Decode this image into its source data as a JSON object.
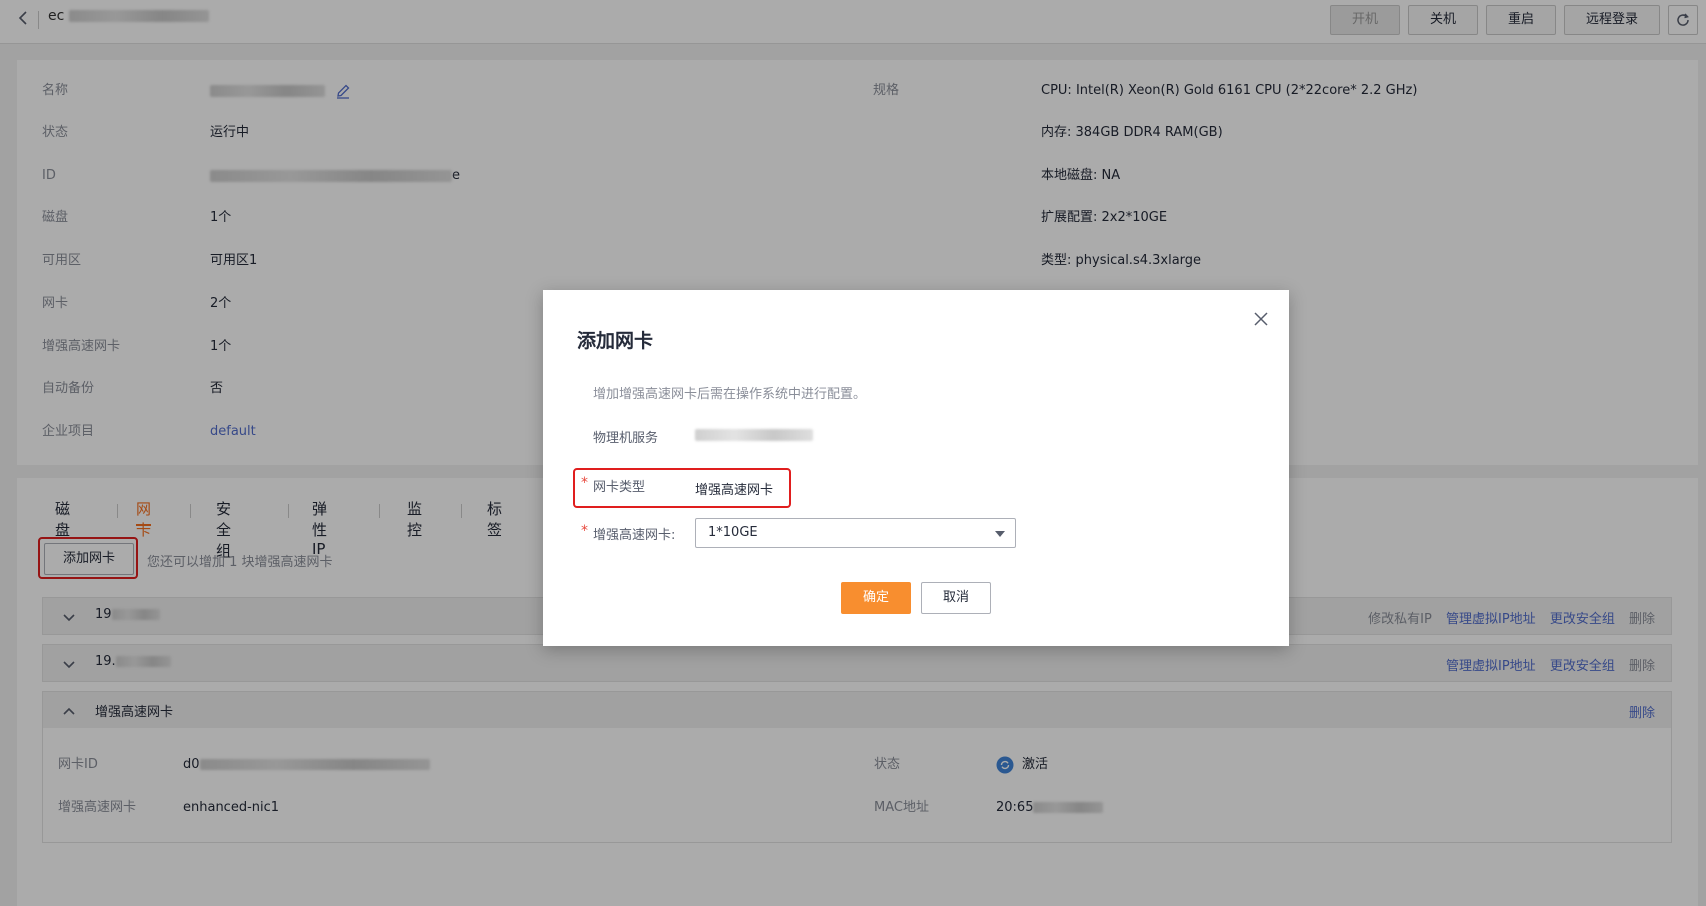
{
  "topbar": {
    "title": "ec",
    "buttons": {
      "power_on": "开机",
      "power_off": "关机",
      "restart": "重启",
      "remote_login": "远程登录"
    }
  },
  "info": {
    "left": [
      {
        "label": "名称",
        "value": ""
      },
      {
        "label": "状态",
        "value": "运行中"
      },
      {
        "label": "ID",
        "value": "e"
      },
      {
        "label": "磁盘",
        "value": "1个"
      },
      {
        "label": "可用区",
        "value": "可用区1"
      },
      {
        "label": "网卡",
        "value": "2个"
      },
      {
        "label": "增强高速网卡",
        "value": "1个"
      },
      {
        "label": "自动备份",
        "value": "否"
      },
      {
        "label": "企业项目",
        "value": "default"
      }
    ],
    "spec_label": "规格",
    "spec": [
      "CPU: Intel(R) Xeon(R) Gold 6161 CPU (2*22core* 2.2 GHz)",
      "内存: 384GB DDR4 RAM(GB)",
      "本地磁盘: NA",
      "扩展配置: 2x2*10GE",
      "类型: physical.s4.3xlarge"
    ]
  },
  "tabs": [
    "磁盘",
    "网卡",
    "安全组",
    "弹性IP",
    "监控",
    "标签"
  ],
  "nic_section": {
    "add_button": "添加网卡",
    "hint": "您还可以增加 1 块增强高速网卡",
    "rows": [
      {
        "name": "19",
        "actions": [
          "修改私有IP",
          "管理虚拟IP地址",
          "更改安全组",
          "删除"
        ]
      },
      {
        "name": "19.",
        "actions": [
          "管理虚拟IP地址",
          "更改安全组",
          "删除"
        ]
      },
      {
        "name": "增强高速网卡",
        "actions": [
          "删除"
        ]
      }
    ],
    "detail": {
      "nic_id_label": "网卡ID",
      "nic_id_value": "d0",
      "enh_label": "增强高速网卡",
      "enh_value": "enhanced-nic1",
      "status_label": "状态",
      "status_value": "激活",
      "mac_label": "MAC地址",
      "mac_value": "20:65"
    }
  },
  "dialog": {
    "title": "添加网卡",
    "description": "增加增强高速网卡后需在操作系统中进行配置。",
    "server_label": "物理机服务",
    "server_value": "",
    "nic_type_label": "网卡类型",
    "nic_type_value": "增强高速网卡",
    "enh_nic_label": "增强高速网卡:",
    "enh_nic_value": "1*10GE",
    "required_mark": "*",
    "ok": "确定",
    "cancel": "取消"
  },
  "colors": {
    "accent": "#f66f1e",
    "link": "#526ecc",
    "primary_button": "#f88e2f",
    "highlight_box": "#e01e1e"
  }
}
